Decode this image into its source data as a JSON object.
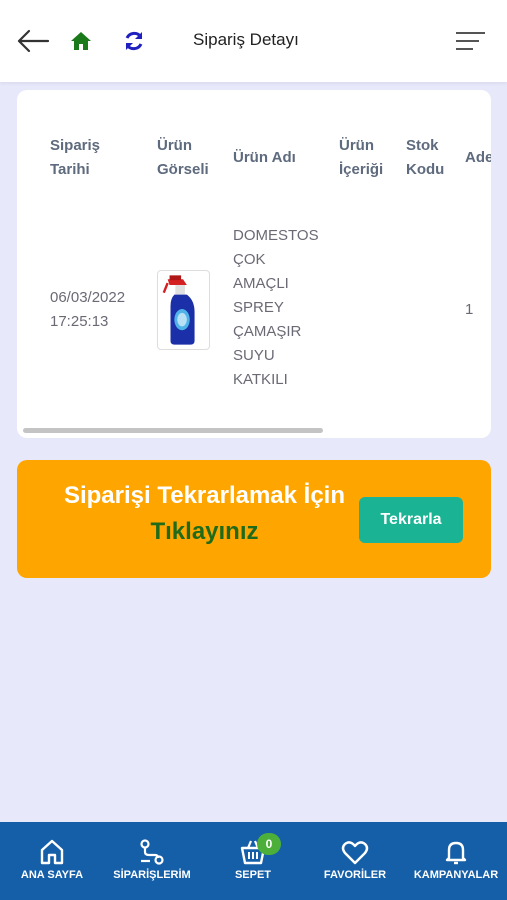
{
  "header": {
    "title": "Sipariş Detayı",
    "icons": [
      "back-arrow-icon",
      "home-icon",
      "refresh-icon",
      "menu-icon"
    ]
  },
  "table": {
    "headers": [
      [
        "Sipariş",
        "Tarihi"
      ],
      [
        "Ürün",
        "Görseli"
      ],
      [
        "Ürün Adı"
      ],
      [
        "Ürün",
        "İçeriği"
      ],
      [
        "Stok",
        "Kodu"
      ],
      [
        "Ade"
      ]
    ],
    "row": {
      "date": "06/03/2022",
      "time": "17:25:13",
      "name_lines": [
        "DOMESTOS",
        "ÇOK",
        "AMAÇLI",
        "SPREY",
        "ÇAMAŞIR",
        "SUYU",
        "KATKILI"
      ],
      "content": "",
      "stock_code": "",
      "quantity": "1"
    }
  },
  "banner": {
    "line1": "Siparişi Tekrarlamak İçin",
    "line2": "Tıklayınız",
    "button": "Tekrarla"
  },
  "bottom_nav": [
    {
      "label": "ANA SAYFA",
      "icon": "home-icon"
    },
    {
      "label": "SİPARİŞLERİM",
      "icon": "orders-icon"
    },
    {
      "label": "SEPET",
      "icon": "basket-icon",
      "badge": "0"
    },
    {
      "label": "FAVORİLER",
      "icon": "heart-icon"
    },
    {
      "label": "KAMPANYALAR",
      "icon": "bell-icon"
    }
  ],
  "colors": {
    "background": "#e8e8fb",
    "banner": "#ffa500",
    "button": "#1ab394",
    "nav": "#155fa8",
    "home_icon": "#1a7a1a",
    "refresh_icon": "#2020c0"
  }
}
